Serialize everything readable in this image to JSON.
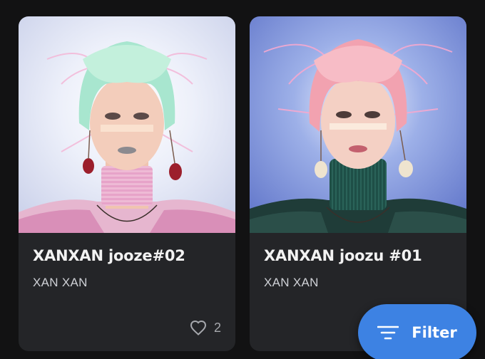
{
  "cards": [
    {
      "title": "XANXAN jooze#02",
      "creator": "XAN XAN",
      "likes": "2",
      "hair_color": "#a8e6cf"
    },
    {
      "title": "XANXAN joozu #01",
      "creator": "XAN XAN",
      "hair_color": "#f2a2b0"
    }
  ],
  "filter_button": {
    "label": "Filter",
    "color": "#3d82e3"
  },
  "icons": {
    "like": "heart-outline-icon",
    "filter": "filter-lines-icon"
  }
}
